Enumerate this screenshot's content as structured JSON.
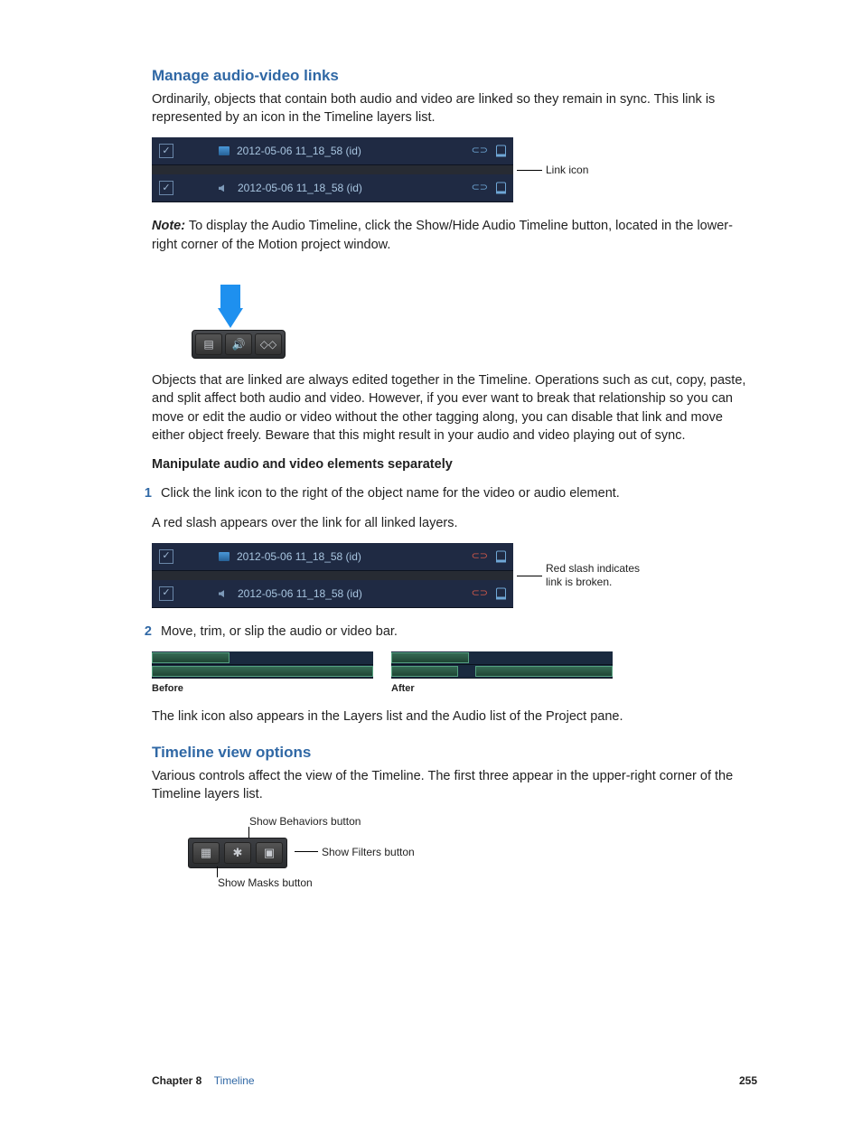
{
  "section1": {
    "heading": "Manage audio-video links",
    "intro": "Ordinarily, objects that contain both audio and video are linked so they remain in sync. This link is represented by an icon in the Timeline layers list.",
    "fig1": {
      "video_name": "2012-05-06 11_18_58 (id)",
      "audio_name": "2012-05-06 11_18_58 (id)",
      "callout": "Link icon"
    },
    "note_label": "Note:",
    "note_text": "To display the Audio Timeline, click the Show/Hide Audio Timeline button, located in the lower-right corner of the Motion project window.",
    "para_linked": "Objects that are linked are always edited together in the Timeline. Operations such as cut, copy, paste, and split affect both audio and video. However, if you ever want to break that relationship so you can move or edit the audio or video without the other tagging along, you can disable that link and move either object freely. Beware that this might result in your audio and video playing out of sync.",
    "sub_heading": "Manipulate audio and video elements separately",
    "step1_num": "1",
    "step1_text": "Click the link icon to the right of the object name for the video or audio element.",
    "step1_result": "A red slash appears over the link for all linked layers.",
    "fig2": {
      "video_name": "2012-05-06 11_18_58 (id)",
      "audio_name": "2012-05-06 11_18_58 (id)",
      "callout": "Red slash indicates link is broken."
    },
    "step2_num": "2",
    "step2_text": "Move, trim, or slip the audio or video bar.",
    "ba_before": "Before",
    "ba_after": "After",
    "para_final": "The link icon also appears in the Layers list and the Audio list of the Project pane."
  },
  "section2": {
    "heading": "Timeline view options",
    "intro": "Various controls affect the view of the Timeline. The first three appear in the upper-right corner of the Timeline layers list.",
    "labels": {
      "behaviors": "Show Behaviors button",
      "filters": "Show Filters button",
      "masks": "Show Masks button"
    }
  },
  "footer": {
    "chapter": "Chapter 8",
    "title": "Timeline",
    "page": "255"
  }
}
